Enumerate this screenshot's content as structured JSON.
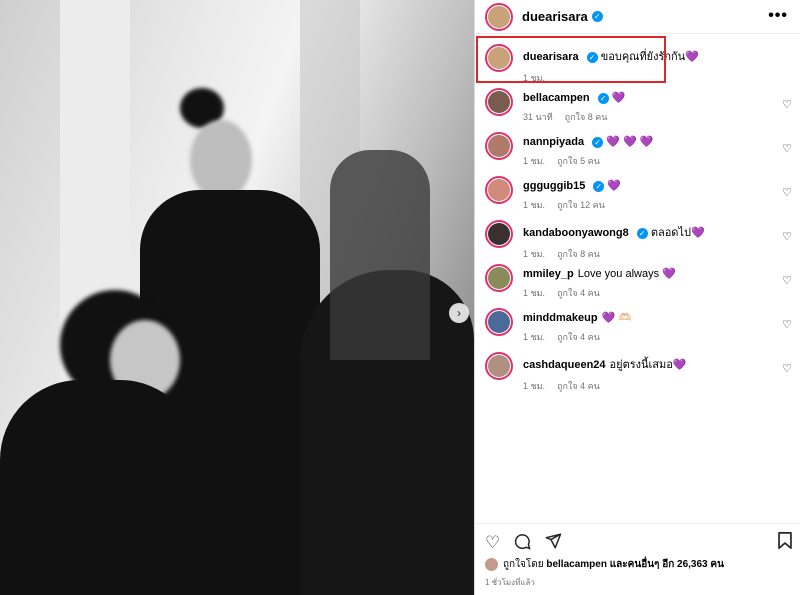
{
  "post": {
    "author": "duearisara",
    "more_label": "•••"
  },
  "comments": [
    {
      "user": "duearisara",
      "text": "ขอบคุณที่ยังรักกัน💜",
      "time": "1 ชม.",
      "likes": "",
      "verified": true,
      "avatar_color": "#c9a27a"
    },
    {
      "user": "bellacampen",
      "text": "💜",
      "time": "31 นาที",
      "likes": "ถูกใจ 8 คน",
      "verified": true,
      "avatar_color": "#7a5c4e"
    },
    {
      "user": "nannpiyada",
      "text": "💜 💜 💜",
      "time": "1 ชม.",
      "likes": "ถูกใจ 5 คน",
      "verified": true,
      "avatar_color": "#b07a6a"
    },
    {
      "user": "ggguggib15",
      "text": "💜",
      "time": "1 ชม.",
      "likes": "ถูกใจ 12 คน",
      "verified": true,
      "avatar_color": "#d28a7a"
    },
    {
      "user": "kandaboonyawong8",
      "text": "ตลอดไป💜",
      "time": "1 ชม.",
      "likes": "ถูกใจ 8 คน",
      "verified": true,
      "avatar_color": "#3a3030"
    },
    {
      "user": "mmiley_p",
      "text": "Love you always 💜",
      "time": "1 ชม.",
      "likes": "ถูกใจ 4 คน",
      "verified": false,
      "avatar_color": "#8a8a5a"
    },
    {
      "user": "minddmakeup",
      "text": "💜 🫶🏻",
      "time": "1 ชม.",
      "likes": "ถูกใจ 4 คน",
      "verified": false,
      "avatar_color": "#4a6a9a"
    },
    {
      "user": "cashdaqueen24",
      "text": "อยู่ตรงนี้เสมอ💜",
      "time": "1 ชม.",
      "likes": "ถูกใจ 4 คน",
      "verified": false,
      "avatar_color": "#b09080"
    }
  ],
  "footer": {
    "liked_by_prefix": "ถูกใจโดย",
    "liked_by_user": "bellacampen",
    "liked_by_suffix": "และคนอื่นๆ อีก 26,363 คน",
    "time_ago": "1 ชั่วโมงที่แล้ว"
  },
  "icons": {
    "heart": "heart-icon",
    "comment": "comment-icon",
    "share": "share-icon",
    "save": "bookmark-icon",
    "next": "chevron-right-icon"
  },
  "colors": {
    "verified": "#0095f6",
    "highlight": "#e0262b",
    "story_ring": "#e1306c"
  }
}
